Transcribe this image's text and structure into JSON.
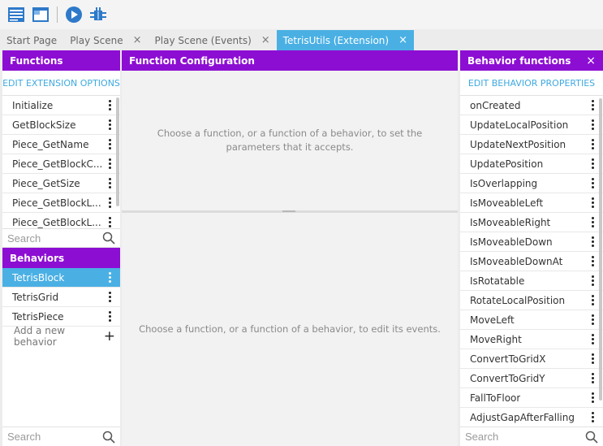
{
  "tabs": [
    {
      "label": "Start Page",
      "closable": false,
      "active": false
    },
    {
      "label": "Play Scene",
      "closable": true,
      "active": false
    },
    {
      "label": "Play Scene (Events)",
      "closable": true,
      "active": false
    },
    {
      "label": "TetrisUtils (Extension)",
      "closable": true,
      "active": true
    }
  ],
  "tab_close_glyph": "×",
  "functions_panel": {
    "title": "Functions",
    "link": "EDIT EXTENSION OPTIONS",
    "items": [
      "Initialize",
      "GetBlockSize",
      "Piece_GetName",
      "Piece_GetBlockC...",
      "Piece_GetSize",
      "Piece_GetBlockL...",
      "Piece_GetBlockL..."
    ],
    "search_placeholder": "Search"
  },
  "behaviors_panel": {
    "title": "Behaviors",
    "items": [
      "TetrisBlock",
      "TetrisGrid",
      "TetrisPiece"
    ],
    "selected_index": 0,
    "add_label": "Add a new behavior",
    "search_placeholder": "Search"
  },
  "center_panel": {
    "title": "Function Configuration",
    "top_message": "Choose a function, or a function of a behavior, to set the parameters that it accepts.",
    "bottom_message": "Choose a function, or a function of a behavior, to edit its events."
  },
  "behavior_functions_panel": {
    "title": "Behavior functions",
    "close_glyph": "×",
    "link": "EDIT BEHAVIOR PROPERTIES",
    "items": [
      "onCreated",
      "UpdateLocalPosition",
      "UpdateNextPosition",
      "UpdatePosition",
      "IsOverlapping",
      "IsMoveableLeft",
      "IsMoveableRight",
      "IsMoveableDown",
      "IsMoveableDownAt",
      "IsRotatable",
      "RotateLocalPosition",
      "MoveLeft",
      "MoveRight",
      "ConvertToGridX",
      "ConvertToGridY",
      "FallToFloor",
      "AdjustGapAfterFalling"
    ],
    "search_placeholder": "Search"
  },
  "toolbar_icons": [
    "project-manager-icon",
    "scene-window-icon",
    "preview-play-icon",
    "debugger-bug-icon"
  ],
  "colors": {
    "accent_purple": "#8d0ed3",
    "accent_blue": "#4ab0e4",
    "link_blue": "#3ea9e0"
  }
}
